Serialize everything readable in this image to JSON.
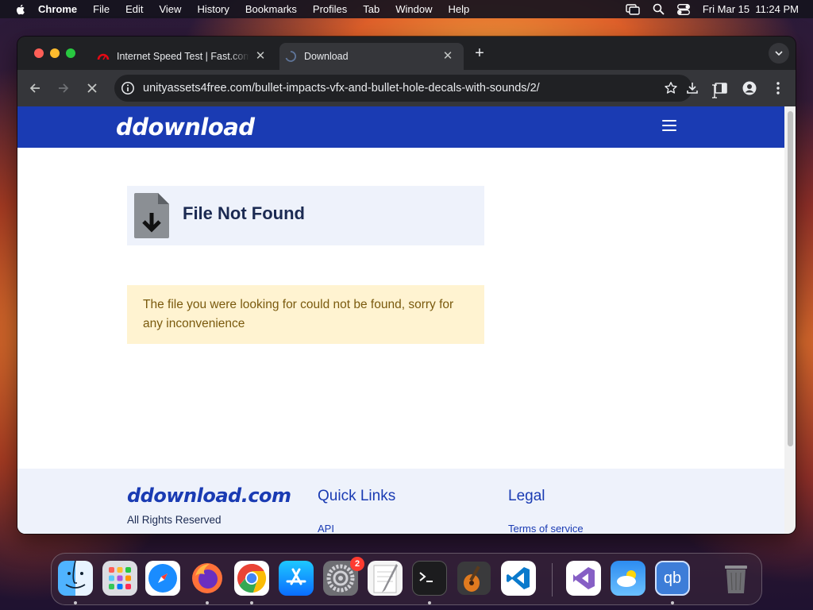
{
  "menubar": {
    "app_name": "Chrome",
    "menus": [
      "File",
      "Edit",
      "View",
      "History",
      "Bookmarks",
      "Profiles",
      "Tab",
      "Window",
      "Help"
    ],
    "datetime": "Fri Mar 15  11:24 PM"
  },
  "browser": {
    "tabs": [
      {
        "title": "Internet Speed Test | Fast.com",
        "active": false
      },
      {
        "title": "Download",
        "active": true
      }
    ],
    "new_tab_symbol": "+",
    "url": "unityassets4free.com/bullet-impacts-vfx-and-bullet-hole-decals-with-sounds/2/"
  },
  "page": {
    "logo": "ddownload",
    "not_found_title": "File Not Found",
    "message": "The file you were looking for could not be found, sorry for any inconvenience",
    "footer": {
      "logo": "ddownload.com",
      "rights": "All Rights Reserved",
      "quick_links_title": "Quick Links",
      "quick_links": [
        "API"
      ],
      "legal_title": "Legal",
      "legal_links": [
        "Terms of service"
      ]
    }
  },
  "dock": {
    "apps": [
      "Finder",
      "Launchpad",
      "Safari",
      "Firefox",
      "Google Chrome",
      "App Store",
      "System Settings",
      "TextEdit",
      "Terminal",
      "GarageBand",
      "Visual Studio Code",
      "Visual Studio",
      "Weather",
      "qBittorrent",
      "Trash"
    ],
    "settings_badge": "2",
    "qb_label": "qb"
  },
  "colors": {
    "brand_blue": "#1a3bb3",
    "notice_bg": "#fff3d1",
    "notice_text": "#7a5a0e",
    "panel_bg": "#eef2fb"
  }
}
